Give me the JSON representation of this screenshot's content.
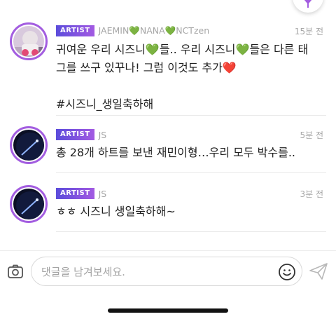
{
  "top_action": {
    "icon": "purple-funnel-icon"
  },
  "comments": [
    {
      "badge": "ARTIST",
      "author": "JAEMIN💚NANA💚NCTzen",
      "time": "15분 전",
      "avatar": "jaemin-photo-avatar",
      "lines": [
        "귀여운 우리 시즈니💚들.. 우리 시즈니💚들은 다른 태",
        "그를 쓰구 있꾸나! 그럼 이것도 추가❤️",
        "",
        "#시즈니_생일축하해"
      ]
    },
    {
      "badge": "ARTIST",
      "author": "JS",
      "time": "5분 전",
      "avatar": "night-sky-avatar",
      "lines": [
        "총 28개 하트를 보낸 재민이형…우리 모두 박수를.."
      ]
    },
    {
      "badge": "ARTIST",
      "author": "JS",
      "time": "3분 전",
      "avatar": "night-sky-avatar",
      "lines": [
        "ㅎㅎ 시즈니 생일축하해~"
      ]
    }
  ],
  "composer": {
    "placeholder": "댓글을 남겨보세요.",
    "camera_icon": "camera-icon",
    "emoji_icon": "smiley-icon",
    "send_icon": "send-icon"
  },
  "colors": {
    "accent": "#a35de0",
    "badge_start": "#5b4cdb",
    "badge_end": "#a35ae2"
  }
}
